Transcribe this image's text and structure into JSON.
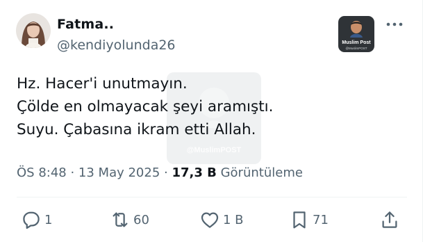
{
  "author": {
    "name": "Fatma..",
    "handle": "@kendiyolunda26"
  },
  "badge": {
    "title": "Muslim Post",
    "subtitle": "@MuslimPOST"
  },
  "watermark": {
    "text": "@MuslimPOST"
  },
  "tweet": {
    "lines": [
      "Hz. Hacer'i unutmayın.",
      "Çölde en olmayacak şeyi aramıştı.",
      "Suyu. Çabasına ikram etti Allah."
    ]
  },
  "meta": {
    "time": "ÖS 8:48",
    "separator1": " · ",
    "date": "13 May 2025",
    "separator2": " · ",
    "views": "17,3 B",
    "views_label": " Görüntüleme"
  },
  "actions": {
    "reply_count": "1",
    "retweet_count": "60",
    "like_count": "1 B",
    "bookmark_count": "71"
  },
  "colors": {
    "text": "#0f1419",
    "secondary": "#536471",
    "divider": "#eff3f4"
  }
}
